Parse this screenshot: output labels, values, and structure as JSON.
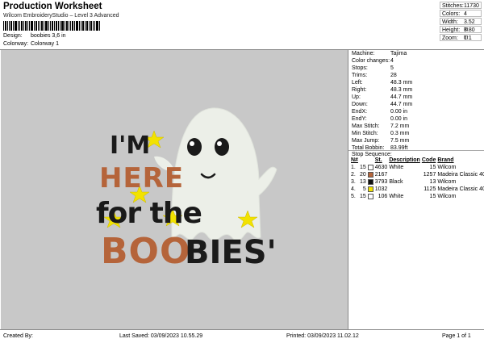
{
  "header": {
    "title": "Production Worksheet",
    "subtitle": "Wilcom EmbroideryStudio – Level 3 Advanced",
    "design_label": "Design:",
    "design_value": "boobies 3,6 in",
    "colorway_label": "Colorway:",
    "colorway_value": "Colorway 1"
  },
  "summary": {
    "stitches_label": "Stitches:",
    "stitches_value": "11730",
    "colors_label": "Colors:",
    "colors_value": "4",
    "width_label": "Width:",
    "width_value": "3.52 in",
    "height_label": "Height:",
    "height_value": "3.80 in",
    "zoom_label": "Zoom:",
    "zoom_value": "1:1"
  },
  "design_text": {
    "line1": "I'M",
    "line2": "HERE",
    "line3": "for the",
    "line4a": "BOO",
    "line4b": "BIES'"
  },
  "specs": [
    {
      "label": "Machine:",
      "value": "Tajima"
    },
    {
      "label": "Color changes:",
      "value": "4"
    },
    {
      "label": "Stops:",
      "value": "5"
    },
    {
      "label": "Trims:",
      "value": "28"
    },
    {
      "label": "Left:",
      "value": "48.3 mm"
    },
    {
      "label": "Right:",
      "value": "48.3 mm"
    },
    {
      "label": "Up:",
      "value": "44.7 mm"
    },
    {
      "label": "Down:",
      "value": "44.7 mm"
    },
    {
      "label": "EndX:",
      "value": "0.00 in"
    },
    {
      "label": "EndY:",
      "value": "0.00 in"
    },
    {
      "label": "Max Stitch:",
      "value": "7.2 mm"
    },
    {
      "label": "Min Stitch:",
      "value": "0.3 mm"
    },
    {
      "label": "Max Jump:",
      "value": "7.5 mm"
    },
    {
      "label": "Total Bobbin:",
      "value": "83.99ft"
    }
  ],
  "stop_sequence": {
    "title": "Stop Sequence:",
    "headers": {
      "num": "N#",
      "st": "St.",
      "description": "Description",
      "code": "Code",
      "brand": "Brand"
    },
    "rows": [
      {
        "num": "1.",
        "n": "15",
        "swatch": "#ffffff",
        "st": "4630",
        "description": "White",
        "code": "15",
        "brand": "Wilcom"
      },
      {
        "num": "2.",
        "n": "20",
        "swatch": "#b5643a",
        "st": "2167",
        "description": "",
        "code": "1257",
        "brand": "Madeira Classic 40"
      },
      {
        "num": "3.",
        "n": "13",
        "swatch": "#111111",
        "st": "3793",
        "description": "Black",
        "code": "13",
        "brand": "Wilcom"
      },
      {
        "num": "4.",
        "n": "5",
        "swatch": "#f2e200",
        "st": "1032",
        "description": "",
        "code": "1125",
        "brand": "Madeira Classic 40"
      },
      {
        "num": "5.",
        "n": "15",
        "swatch": "#ffffff",
        "st": "106",
        "description": "White",
        "code": "15",
        "brand": "Wilcom"
      }
    ]
  },
  "footer": {
    "created_by": "Created By:",
    "last_saved": "Last Saved: 03/09/2023 10.55.29",
    "printed": "Printed: 03/09/2023 11.02.12",
    "page": "Page 1 of 1"
  },
  "colors": {
    "orange": "#b5643a",
    "black": "#1a1a1a",
    "yellow": "#f2e200",
    "ghost": "#ecefe8",
    "preview_bg": "#c8c8c8"
  }
}
